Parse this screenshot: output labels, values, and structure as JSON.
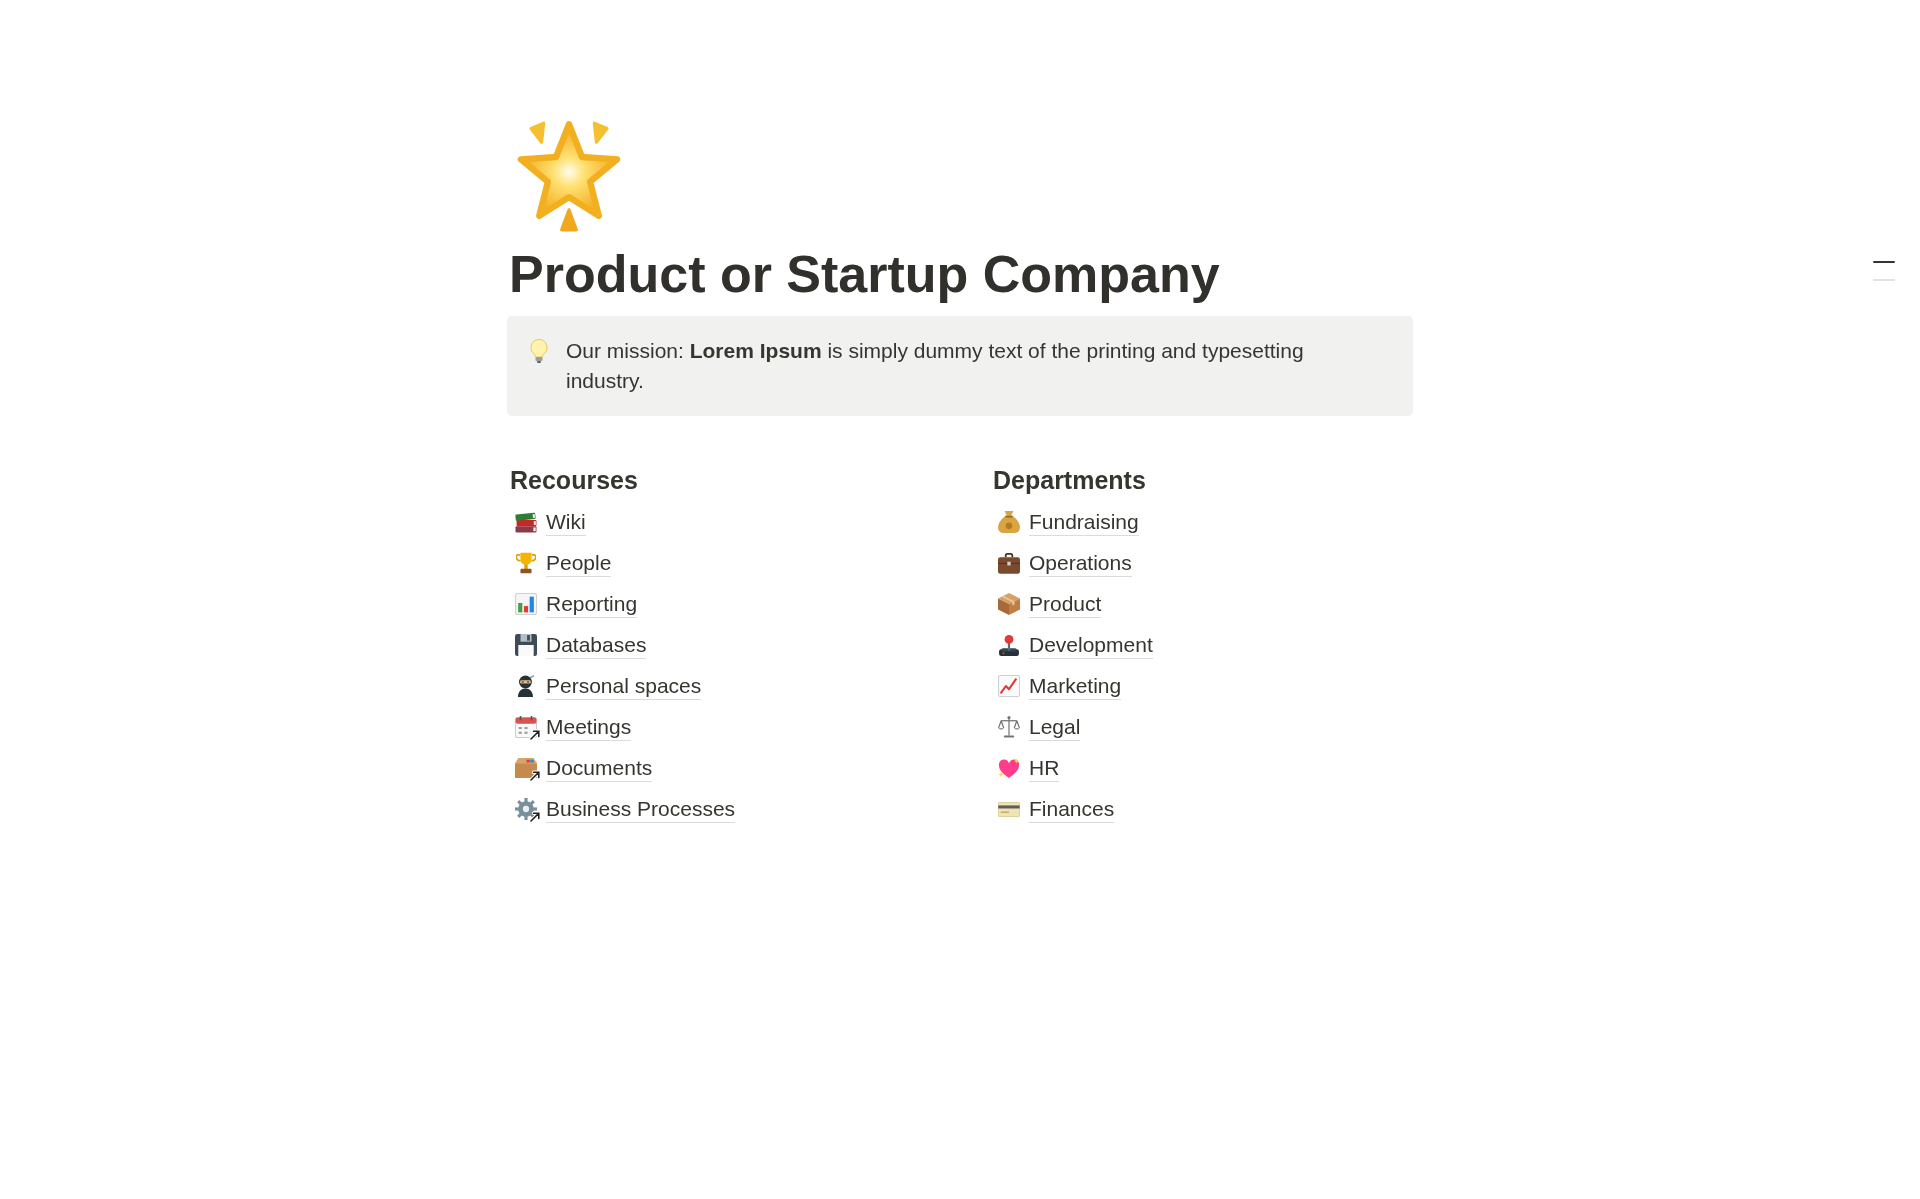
{
  "page": {
    "title": "Product or Startup Company"
  },
  "callout": {
    "text": "Our mission: **Lorem Ipsum** is simply dummy text of the printing and typesetting industry."
  },
  "columns": [
    {
      "heading": "Recourses",
      "links": [
        {
          "label": "Wiki",
          "linked": false
        },
        {
          "label": "People",
          "linked": false
        },
        {
          "label": "Reporting",
          "linked": false
        },
        {
          "label": "Databases",
          "linked": false
        },
        {
          "label": "Personal spaces",
          "linked": false
        },
        {
          "label": "Meetings",
          "linked": true
        },
        {
          "label": "Documents",
          "linked": true
        },
        {
          "label": "Business Processes",
          "linked": true
        }
      ]
    },
    {
      "heading": "Departments",
      "links": [
        {
          "label": "Fundraising",
          "linked": false
        },
        {
          "label": "Operations",
          "linked": false
        },
        {
          "label": "Product",
          "linked": false
        },
        {
          "label": "Development",
          "linked": false
        },
        {
          "label": "Marketing",
          "linked": false
        },
        {
          "label": "Legal",
          "linked": false
        },
        {
          "label": "HR",
          "linked": false
        },
        {
          "label": "Finances",
          "linked": false
        }
      ]
    }
  ]
}
